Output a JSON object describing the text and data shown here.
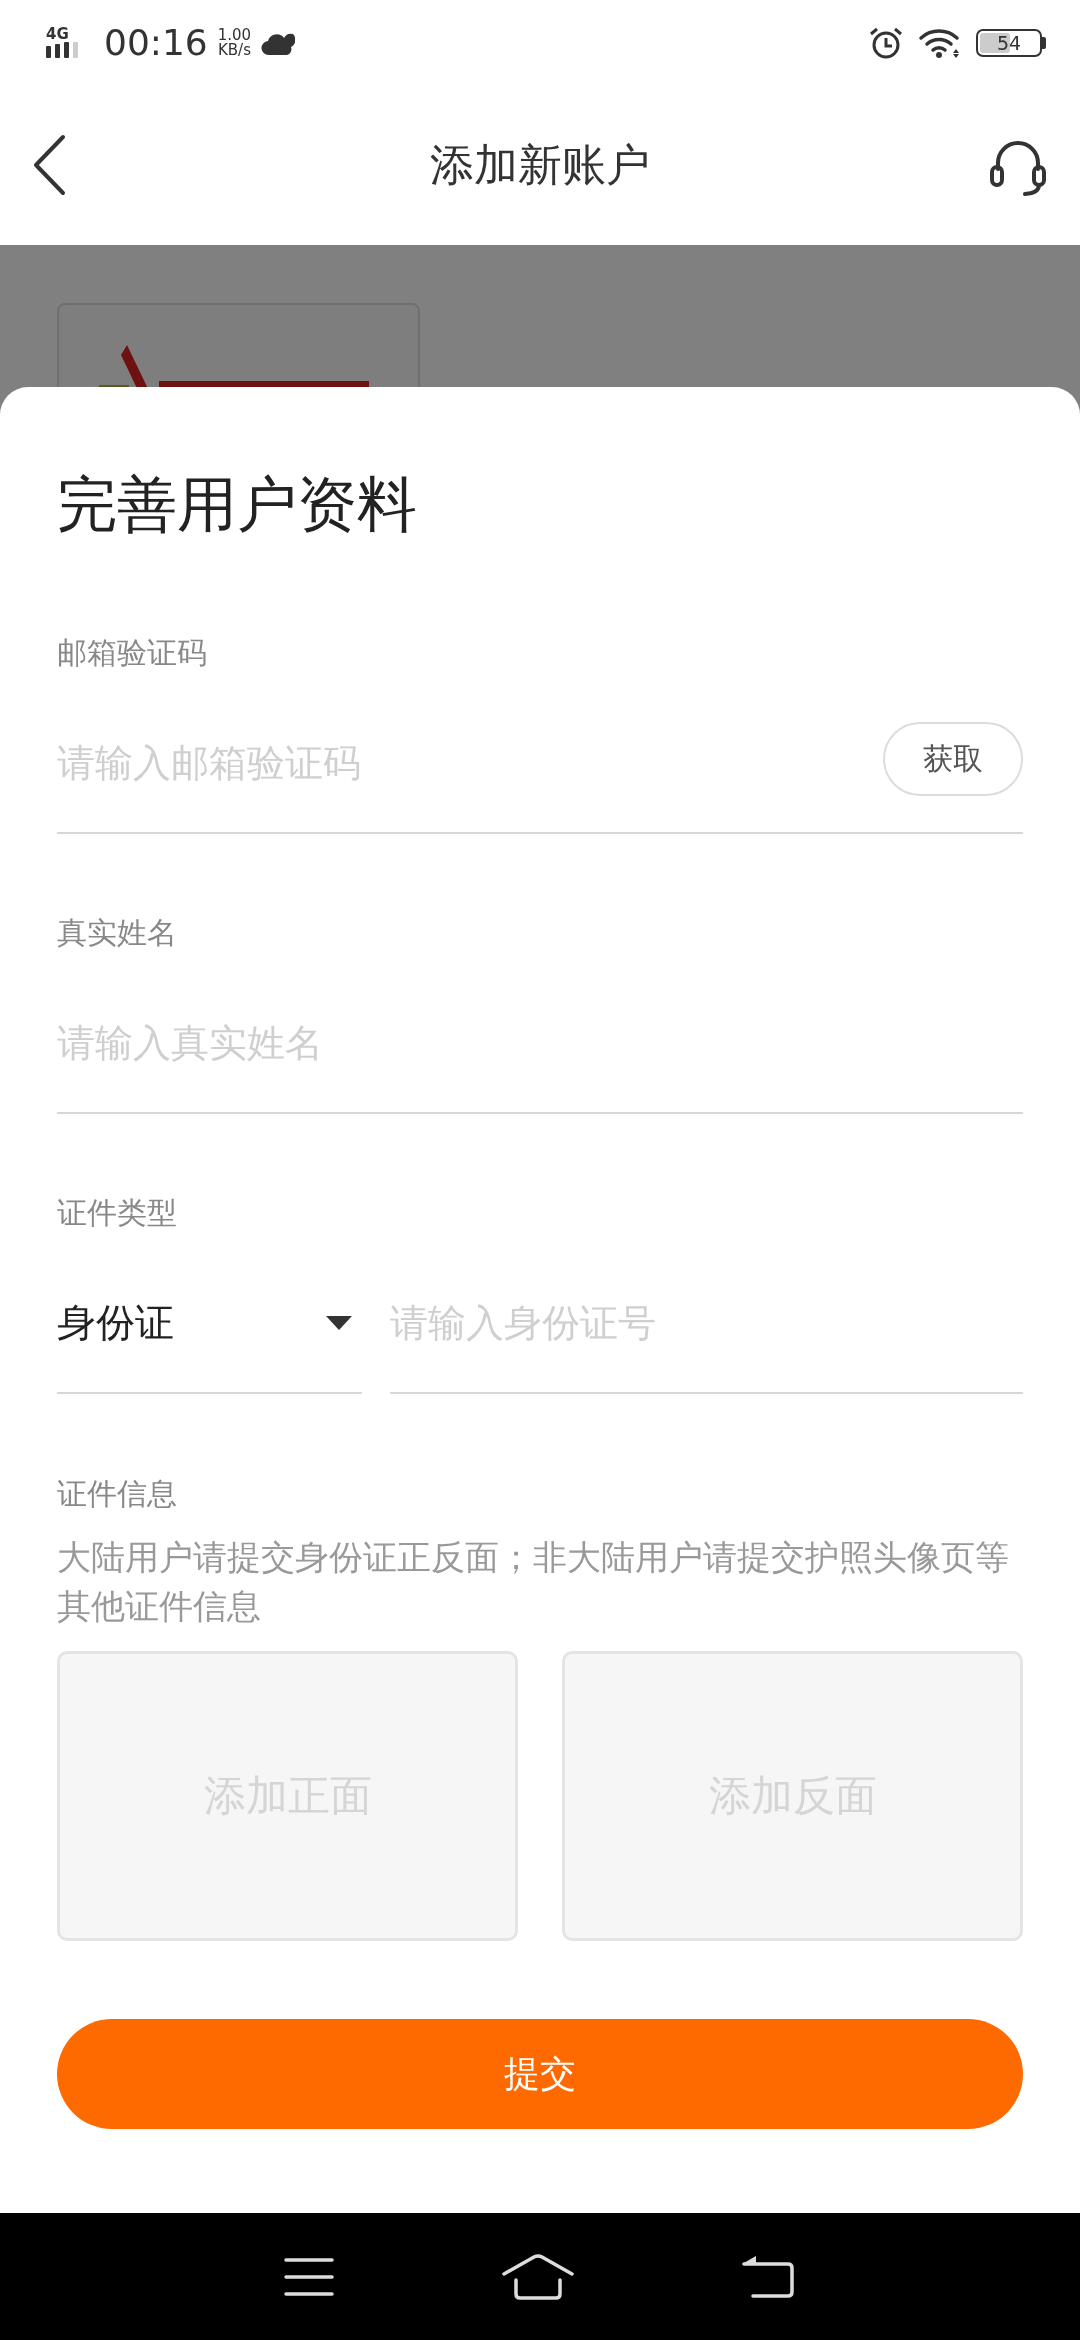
{
  "status_bar": {
    "network": "4G",
    "time": "00:16",
    "speed_value": "1.00",
    "speed_unit": "KB/s",
    "battery": "54"
  },
  "header": {
    "title": "添加新账户"
  },
  "background_card": {
    "kind": "logo"
  },
  "sheet": {
    "title": "完善用户资料",
    "fields": [
      {
        "kind": "code",
        "label": "邮箱验证码",
        "placeholder": "请输入邮箱验证码",
        "button": "获取"
      },
      {
        "kind": "text",
        "label": "真实姓名",
        "placeholder": "请输入真实姓名"
      },
      {
        "kind": "id",
        "label": "证件类型",
        "select_value": "身份证",
        "placeholder": "请输入身份证号"
      }
    ],
    "upload": {
      "label": "证件信息",
      "hint": "大陆用户请提交身份证正反面；非大陆用户请提交护照头像页等其他证件信息",
      "slots": [
        "添加正面",
        "添加反面"
      ]
    },
    "submit": "提交"
  }
}
